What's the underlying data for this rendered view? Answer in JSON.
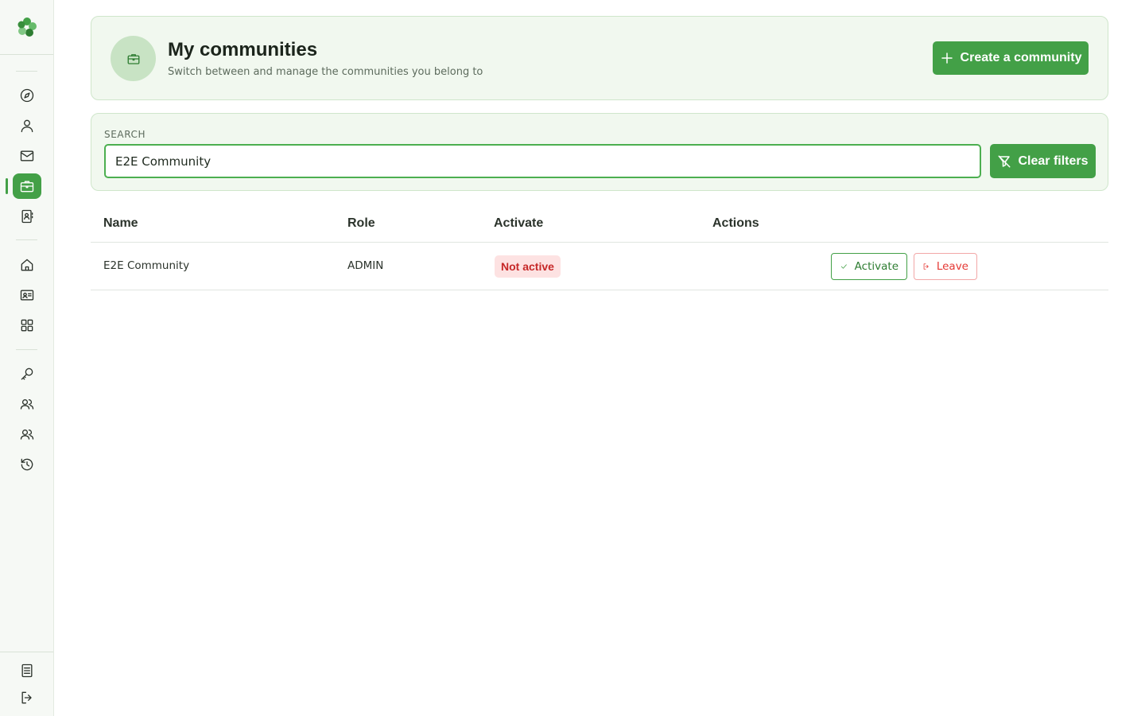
{
  "sidebar": {
    "logo_icon": "clover-logo-icon",
    "top_items": [
      {
        "name": "explore",
        "icon": "compass-icon"
      },
      {
        "name": "profile",
        "icon": "user-icon"
      },
      {
        "name": "messages",
        "icon": "mail-icon"
      },
      {
        "name": "communities",
        "icon": "briefcase-icon",
        "active": true
      },
      {
        "name": "contacts",
        "icon": "contact-book-icon"
      }
    ],
    "middle_items": [
      {
        "name": "home",
        "icon": "home-icon"
      },
      {
        "name": "id-card",
        "icon": "id-card-icon"
      },
      {
        "name": "apps",
        "icon": "grid-icon"
      }
    ],
    "lower_items": [
      {
        "name": "keys",
        "icon": "key-icon"
      },
      {
        "name": "members",
        "icon": "users-icon"
      },
      {
        "name": "groups",
        "icon": "users-icon"
      },
      {
        "name": "history",
        "icon": "history-icon"
      }
    ],
    "bottom_items": [
      {
        "name": "docs",
        "icon": "document-icon"
      },
      {
        "name": "logout",
        "icon": "logout-icon"
      }
    ],
    "accent_color": "#43a047"
  },
  "header": {
    "icon": "briefcase-icon",
    "title": "My communities",
    "subtitle": "Switch between and manage the communities you belong to",
    "create_button_label": "Create a community"
  },
  "search": {
    "label": "SEARCH",
    "value": "E2E Community",
    "clear_button_label": "Clear filters"
  },
  "table": {
    "columns": [
      "Name",
      "Role",
      "Activate",
      "Actions"
    ],
    "rows": [
      {
        "name": "E2E Community",
        "role": "ADMIN",
        "status": "Not active",
        "actions": {
          "activate": "Activate",
          "leave": "Leave"
        }
      }
    ]
  },
  "colors": {
    "primary": "#43a047",
    "card_bg": "#f1f8ef",
    "danger": "#e53935",
    "badge_bg": "#fde2e2"
  }
}
